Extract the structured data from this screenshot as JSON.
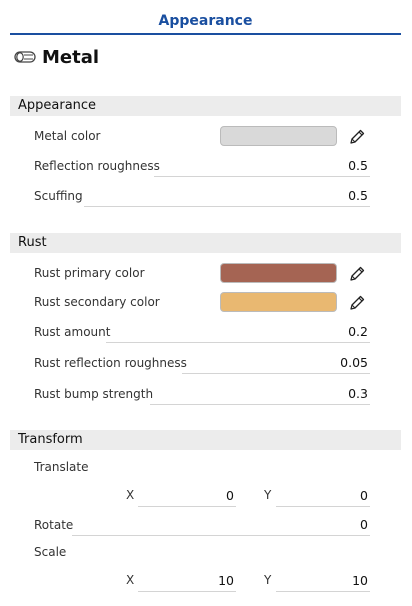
{
  "tab": {
    "title": "Appearance"
  },
  "material": {
    "name": "Metal",
    "icon": "material-roll-icon"
  },
  "sections": {
    "appearance": {
      "title": "Appearance",
      "metal_color": {
        "label": "Metal color",
        "color": "#d9d9d9"
      },
      "reflection_roughness": {
        "label": "Reflection roughness",
        "value": "0.5"
      },
      "scuffing": {
        "label": "Scuffing",
        "value": "0.5"
      }
    },
    "rust": {
      "title": "Rust",
      "primary_color": {
        "label": "Rust primary color",
        "color": "#a56453"
      },
      "secondary_color": {
        "label": "Rust secondary color",
        "color": "#e9b871"
      },
      "amount": {
        "label": "Rust amount",
        "value": "0.2"
      },
      "reflection_roughness": {
        "label": "Rust reflection roughness",
        "value": "0.05"
      },
      "bump_strength": {
        "label": "Rust bump strength",
        "value": "0.3"
      }
    },
    "transform": {
      "title": "Transform",
      "translate": {
        "label": "Translate",
        "x_label": "X",
        "x": "0",
        "y_label": "Y",
        "y": "0"
      },
      "rotate": {
        "label": "Rotate",
        "value": "0"
      },
      "scale": {
        "label": "Scale",
        "x_label": "X",
        "x": "10",
        "y_label": "Y",
        "y": "10"
      }
    }
  },
  "colors": {
    "accent": "#1a4fa0",
    "section_bg": "#ececec"
  }
}
